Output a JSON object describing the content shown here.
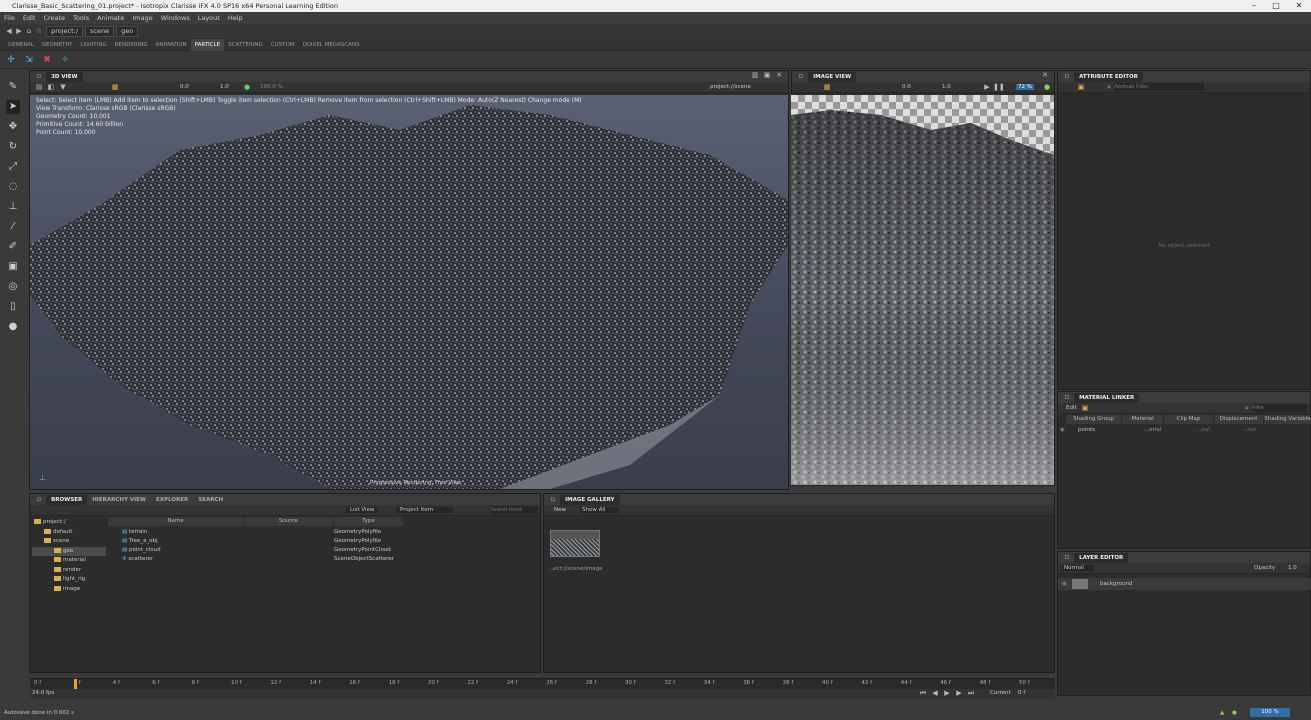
{
  "window": {
    "title": "Clarisse_Basic_Scattering_01.project* - Isotropix Clarisse iFX 4.0 SP16 x64 Personal Learning Edition"
  },
  "menu": [
    "File",
    "Edit",
    "Create",
    "Tools",
    "Animate",
    "Image",
    "Windows",
    "Layout",
    "Help"
  ],
  "path": [
    "project:/",
    "scene",
    "geo"
  ],
  "shelf_tabs": [
    "GENERAL",
    "GEOMETRY",
    "LIGHTING",
    "RENDERING",
    "ANIMATION",
    "PARTICLE",
    "SCATTERING",
    "CUSTOM",
    "QUIXEL MEGASCANS"
  ],
  "active_shelf_tab": "PARTICLE",
  "view3d": {
    "tab": "3D VIEW",
    "toolbar": {
      "val1": "0.0",
      "val2": "1.0",
      "val3": "100.0 %",
      "path": "project://scene"
    },
    "info": [
      "Select: Select item (LMB)  Add item to selection (Shift+LMB)  Toggle item selection (Ctrl+LMB)  Remove item from selection (Ctrl+Shift+LMB)    Mode: Auto(Z Nearest)  Change mode (M)",
      "View Transform: Clarisse sRGB (Clarisse sRGB)",
      "Geometry Count: 10,001",
      "Primitive Count: 14.60 billion",
      "Point Count: 10,000"
    ],
    "footer": "Progressive Rendering: Free View"
  },
  "imageview": {
    "tab": "IMAGE VIEW",
    "zoom": "72 %",
    "val1": "0.0",
    "val2": "1.0"
  },
  "attribute_editor": {
    "tab": "ATTRIBUTE EDITOR",
    "filter_placeholder": "Attribute Filter",
    "empty": "No object selected"
  },
  "material_linker": {
    "tab": "MATERIAL LINKER",
    "edit": "Edit",
    "filter_placeholder": "Filter",
    "columns": [
      "Shading Group",
      "Material",
      "Clip Map",
      "Displacement",
      "Shading Variable"
    ],
    "rows": [
      {
        "group": "points",
        "material": "...erial",
        "clip": "...nul",
        "disp": "...nul"
      }
    ]
  },
  "layer_editor": {
    "tab": "LAYER EDITOR",
    "blend": "Normal",
    "opacity_label": "Opacity",
    "opacity": "1.0",
    "layer": "background"
  },
  "browser": {
    "tabs": [
      "BROWSER",
      "HIERARCHY VIEW",
      "EXPLORER",
      "SEARCH"
    ],
    "view_mode": "List View",
    "filter": "Project Item",
    "search_placeholder": "Search Items",
    "tree": [
      "project:/",
      "default",
      "scene",
      "geo",
      "material",
      "render",
      "light_rig",
      "image"
    ],
    "columns": [
      "Name",
      "Source",
      "Type"
    ],
    "items": [
      {
        "name": "terrain",
        "type": "GeometryPolyfile"
      },
      {
        "name": "Tree_a_obj",
        "type": "GeometryPolyfile"
      },
      {
        "name": "point_cloud",
        "type": "GeometryPointCloud"
      },
      {
        "name": "scatterer",
        "type": "SceneObjectScatterer"
      }
    ]
  },
  "gallery": {
    "tab": "IMAGE GALLERY",
    "new": "New",
    "show": "Show All",
    "thumb_label": "...ect://scene/image"
  },
  "timeline": {
    "ticks": [
      "0 f",
      "2 f",
      "4 f",
      "6 f",
      "8 f",
      "10 f",
      "12 f",
      "14 f",
      "16 f",
      "18 f",
      "20 f",
      "22 f",
      "24 f",
      "26 f",
      "28 f",
      "30 f",
      "32 f",
      "34 f",
      "36 f",
      "38 f",
      "40 f",
      "42 f",
      "44 f",
      "46 f",
      "48 f",
      "50 f"
    ],
    "fps": "24.0 fps",
    "current_label": "Current",
    "current": "0 f",
    "end": "50 f"
  },
  "status": {
    "message": "Autosave done in 0.002 s",
    "zoom": "100 %"
  }
}
